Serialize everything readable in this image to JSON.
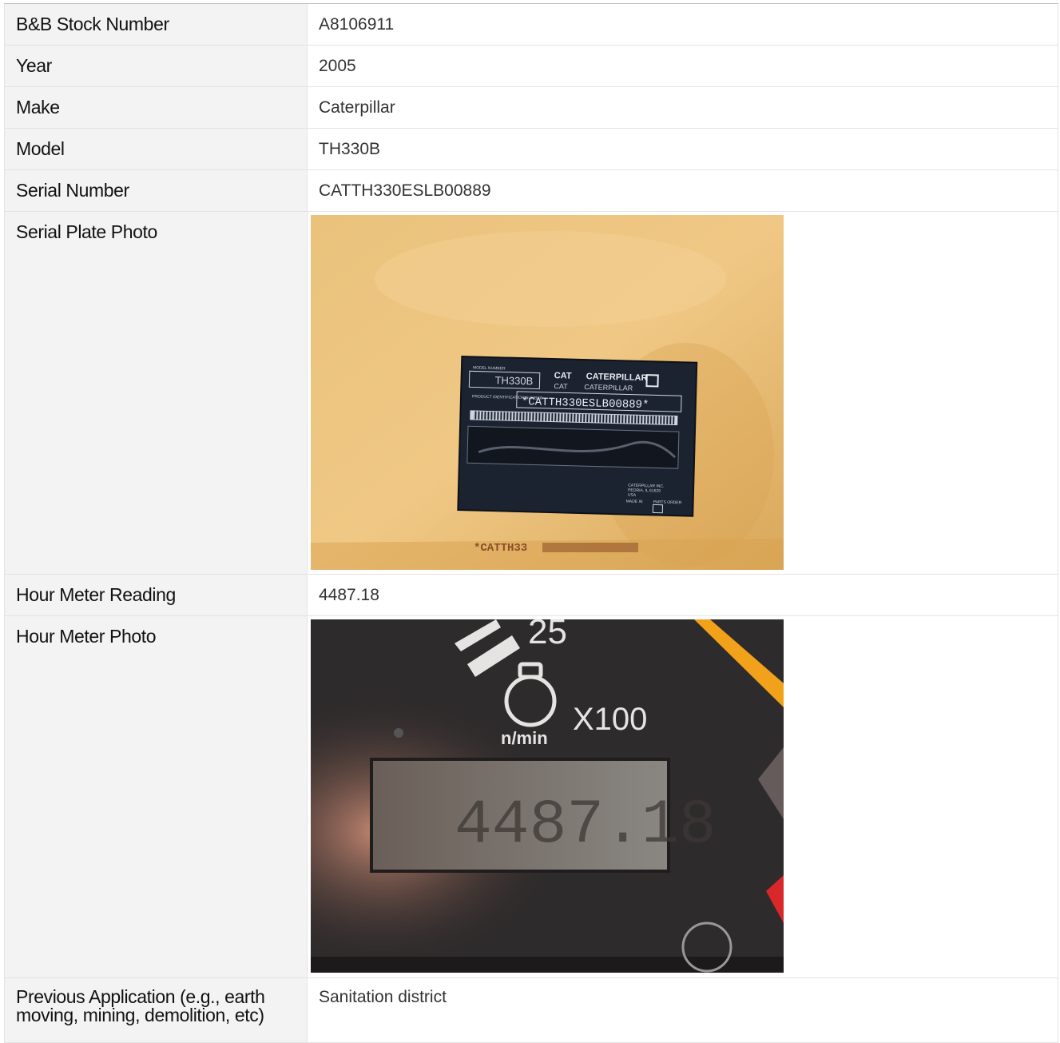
{
  "rows": {
    "stock": {
      "label": "B&B Stock Number",
      "value": "A8106911"
    },
    "year": {
      "label": "Year",
      "value": "2005"
    },
    "make": {
      "label": "Make",
      "value": "Caterpillar"
    },
    "model": {
      "label": "Model",
      "value": "TH330B"
    },
    "serial": {
      "label": "Serial Number",
      "value": "CATTH330ESLB00889"
    },
    "serial_photo": {
      "label": "Serial Plate Photo"
    },
    "hours": {
      "label": "Hour Meter Reading",
      "value": "4487.18"
    },
    "hour_photo": {
      "label": "Hour Meter Photo"
    },
    "application": {
      "label": "Previous Application (e.g., earth moving, mining, demolition, etc)",
      "value": "Sanitation district"
    }
  },
  "serial_plate": {
    "model_caption": "MODEL NUMBER",
    "model": "TH330B",
    "brand_short": "CAT",
    "brand_long": "CATERPILLAR",
    "pin_caption": "PRODUCT IDENTIFICATION NUMBER",
    "pin": "*CATTH330ESLB00889*",
    "stamp": "*CATTH33",
    "maker_lines": [
      "CATERPILLAR INC.",
      "PEORIA, IL 61629",
      "USA"
    ],
    "made_in": "MADE IN",
    "parts": "PARTS ORDER"
  },
  "hour_meter": {
    "gauge_number": "25",
    "unit": "n/min",
    "multiplier": "X100",
    "display": "4487.18"
  }
}
